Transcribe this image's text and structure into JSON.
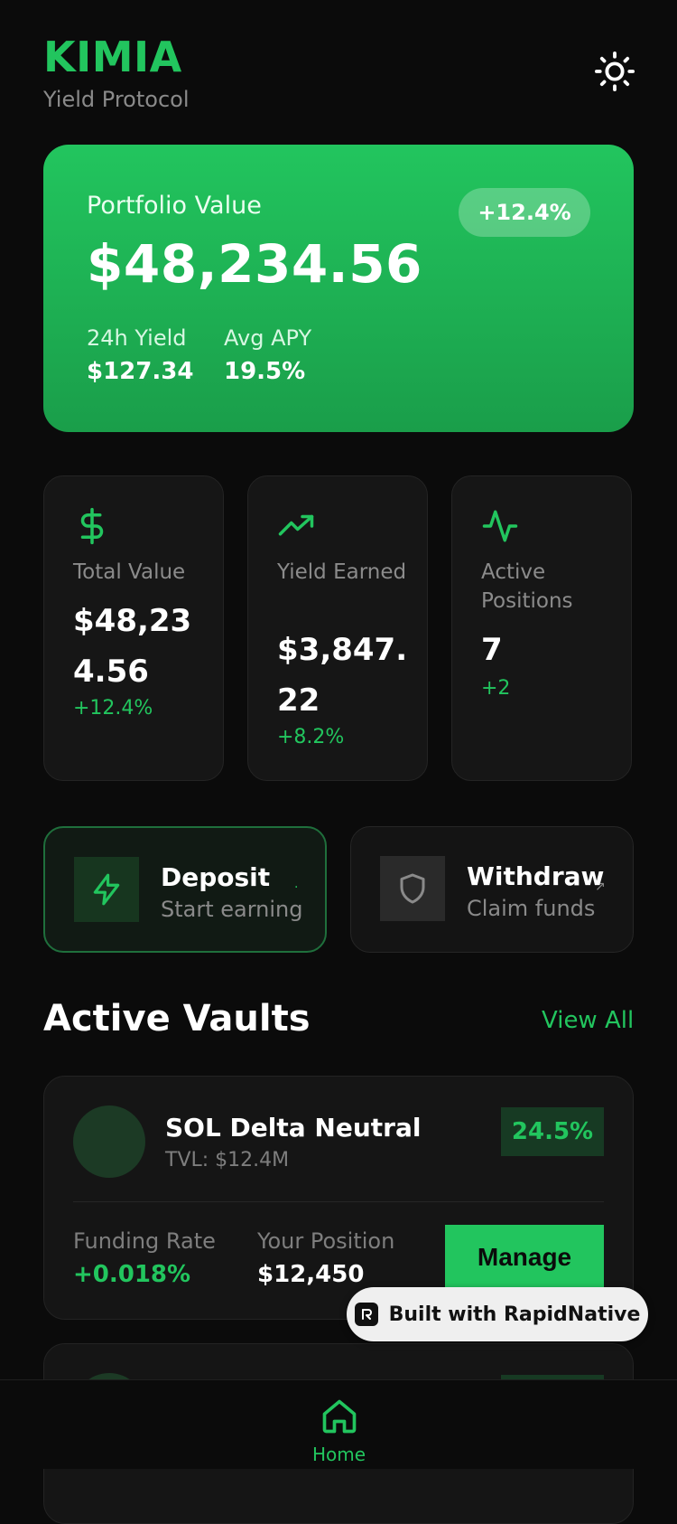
{
  "header": {
    "brand": "KIMIA",
    "tagline": "Yield Protocol",
    "theme_icon": "sun-icon"
  },
  "hero": {
    "label": "Portfolio Value",
    "value": "$48,234.56",
    "badge": "+12.4%",
    "yield_label": "24h Yield",
    "yield_value": "$127.34",
    "apy_label": "Avg APY",
    "apy_value": "19.5%"
  },
  "stats": [
    {
      "icon": "dollar-icon",
      "label": "Total Value",
      "value": "$48,234.56",
      "change": "+12.4%"
    },
    {
      "icon": "trending-up-icon",
      "label": "Yield Earned",
      "value": "$3,847.22",
      "change": "+8.2%"
    },
    {
      "icon": "activity-icon",
      "label": "Active Positions",
      "value": "7",
      "change": "+2"
    }
  ],
  "actions": {
    "deposit": {
      "title": "Deposit",
      "subtitle": "Start earning",
      "icon": "lightning-icon"
    },
    "withdraw": {
      "title": "Withdraw",
      "subtitle": "Claim funds",
      "icon": "shield-icon"
    }
  },
  "vaults_section": {
    "title": "Active Vaults",
    "view_all": "View All"
  },
  "vaults": [
    {
      "name": "SOL Delta Neutral",
      "tvl": "TVL: $12.4M",
      "apy": "24.5%",
      "funding_label": "Funding Rate",
      "funding_value": "+0.018%",
      "position_label": "Your Position",
      "position_value": "$12,450",
      "manage_label": "Manage"
    }
  ],
  "badge": {
    "text": "Built with RapidNative"
  },
  "nav": {
    "home_label": "Home"
  },
  "colors": {
    "accent": "#22c55e",
    "background": "#0b0b0b",
    "card": "#161616"
  }
}
